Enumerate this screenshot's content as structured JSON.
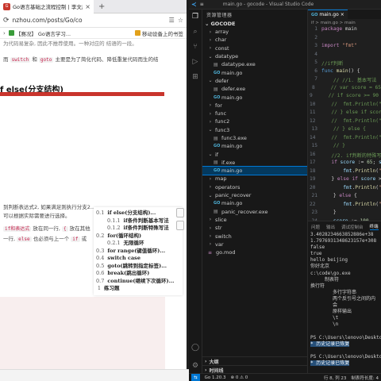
{
  "browser": {
    "tab_title": "Go语言基础之流程控制 | 李文周",
    "tab_close": "×",
    "new_tab": "+",
    "url": "nzhou.com/posts/Go/co",
    "bookmarks": [
      {
        "label": "【赛况】 Go语言学习..."
      },
      {
        "label": "移动设备上的书签"
      }
    ],
    "article": {
      "top_line": "为代码易复杂, 因此不推荐使用。一种对应的 结语的一段。",
      "line2_pre": "而",
      "switch": "switch",
      "line2_mid": "和",
      "goto": "goto",
      "line2_post": "主要是为了简化代码、降低重复代码而生的结",
      "heading": "f else(分支结构)",
      "para1": "到判断表达式2, 如果满足则执行分支2...",
      "para2": "可以根据实际需要进行选择。",
      "para3_code1": "if和表达式",
      "para3_mid": "放在同一行,",
      "para3_brace": "{",
      "para3_post": "放在其他",
      "para4_pre": "一行,",
      "para4_else": "else",
      "para4_mid": "也必须与上一个",
      "para4_if": "if",
      "para4_post": "或"
    },
    "toc": [
      {
        "num": "0.1",
        "text": "if else(分支结构)..."
      },
      {
        "num": "0.1.1",
        "text": "if条件判断基本写法"
      },
      {
        "num": "0.1.2",
        "text": "if条件判断特殊写法"
      },
      {
        "num": "0.2",
        "text": "for(循环结构)"
      },
      {
        "num": "0.2.1",
        "text": "无限循环"
      },
      {
        "num": "0.3",
        "text": "for range(键值循环)..."
      },
      {
        "num": "0.4",
        "text": "switch case"
      },
      {
        "num": "0.5",
        "text": "goto(跳转到指定标签)..."
      },
      {
        "num": "0.6",
        "text": "break(跳出循环)"
      },
      {
        "num": "0.7",
        "text": "continue(继续下次循环)..."
      },
      {
        "num": "1",
        "text": "练习题"
      }
    ]
  },
  "vscode": {
    "window_title": "main.go - gocode - Visual Studio Code",
    "explorer_title": "资源管理器",
    "workspace": "GOCODE",
    "tree": [
      {
        "label": "array",
        "type": "folder",
        "indent": 1,
        "open": false
      },
      {
        "label": "char",
        "type": "folder",
        "indent": 1,
        "open": false
      },
      {
        "label": "const",
        "type": "folder",
        "indent": 1,
        "open": false
      },
      {
        "label": "datatype",
        "type": "folder",
        "indent": 1,
        "open": true
      },
      {
        "label": "datatype.exe",
        "type": "exe",
        "indent": 2
      },
      {
        "label": "main.go",
        "type": "go",
        "indent": 2
      },
      {
        "label": "defer",
        "type": "folder",
        "indent": 1,
        "open": true
      },
      {
        "label": "defer.exe",
        "type": "exe",
        "indent": 2
      },
      {
        "label": "main.go",
        "type": "go",
        "indent": 2
      },
      {
        "label": "for",
        "type": "folder",
        "indent": 1,
        "open": false
      },
      {
        "label": "func",
        "type": "folder",
        "indent": 1,
        "open": false
      },
      {
        "label": "func2",
        "type": "folder",
        "indent": 1,
        "open": false
      },
      {
        "label": "func3",
        "type": "folder",
        "indent": 1,
        "open": true
      },
      {
        "label": "func3.exe",
        "type": "exe",
        "indent": 2
      },
      {
        "label": "main.go",
        "type": "go",
        "indent": 2
      },
      {
        "label": "if",
        "type": "folder",
        "indent": 1,
        "open": true
      },
      {
        "label": "if.exe",
        "type": "exe",
        "indent": 2
      },
      {
        "label": "main.go",
        "type": "go",
        "indent": 2,
        "selected": true
      },
      {
        "label": "map",
        "type": "folder",
        "indent": 1,
        "open": false
      },
      {
        "label": "operators",
        "type": "folder",
        "indent": 1,
        "open": false
      },
      {
        "label": "panic_recover",
        "type": "folder",
        "indent": 1,
        "open": true
      },
      {
        "label": "main.go",
        "type": "go",
        "indent": 2
      },
      {
        "label": "panic_recover.exe",
        "type": "exe",
        "indent": 2
      },
      {
        "label": "slice",
        "type": "folder",
        "indent": 1,
        "open": false
      },
      {
        "label": "str",
        "type": "folder",
        "indent": 1,
        "open": false
      },
      {
        "label": "switch",
        "type": "folder",
        "indent": 1,
        "open": false
      },
      {
        "label": "var",
        "type": "folder",
        "indent": 1,
        "open": false
      },
      {
        "label": "go.mod",
        "type": "mod",
        "indent": 1
      }
    ],
    "outline_label": "大纲",
    "timeline_label": "时间线",
    "go_label": "GO",
    "editor_tab": "main.go",
    "breadcrumb": "if > main.go > main",
    "panel_tabs": [
      "问题",
      "输出",
      "调试控制台",
      "终端",
      "端口"
    ],
    "terminal": [
      {
        "text": "3.4028234663852886e+38",
        "indent": 0
      },
      {
        "text": "1.7976931348623157e+308",
        "indent": 0
      },
      {
        "text": "false",
        "indent": 0
      },
      {
        "text": "true",
        "indent": 0
      },
      {
        "text": "hello beijing",
        "indent": 0
      },
      {
        "text": "你好北京",
        "indent": 0
      },
      {
        "text": "c:\\code\\go.exe",
        "indent": 0
      },
      {
        "text": "制表符",
        "indent": 1
      },
      {
        "text": "换行符",
        "indent": 0
      },
      {
        "text": "多行字符串",
        "indent": 2
      },
      {
        "text": "两个反引号之间的内",
        "indent": 2
      },
      {
        "text": "会",
        "indent": 2
      },
      {
        "text": "原样输出",
        "indent": 2
      },
      {
        "text": "\\t",
        "indent": 2
      },
      {
        "text": "\\n",
        "indent": 2
      },
      {
        "text": "",
        "indent": 0
      },
      {
        "text": "PS C:\\Users\\lenovo\\Desktop",
        "indent": 0
      },
      {
        "text": "* 历史记录已恢复",
        "indent": 0,
        "hl": true
      },
      {
        "text": "",
        "indent": 0
      },
      {
        "text": "PS C:\\Users\\lenovo\\Desktop",
        "indent": 0
      },
      {
        "text": "* 历史记录已恢复",
        "indent": 0,
        "hl": true
      }
    ],
    "status": {
      "go_version": "Go 1.20.3",
      "errors": "⊗ 0 ⚠ 0",
      "position": "行 8, 列 23",
      "indent": "制表符长度: 4"
    }
  }
}
